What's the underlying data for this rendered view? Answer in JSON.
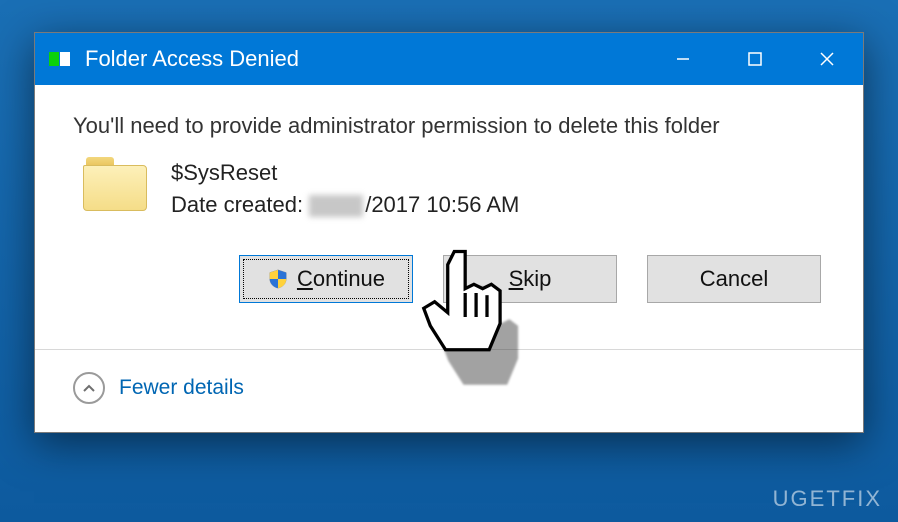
{
  "dialog": {
    "title": "Folder Access Denied",
    "message": "You'll need to provide administrator permission to delete this folder",
    "folder": {
      "name": "$SysReset",
      "date_label": "Date created:",
      "date_suffix": "/2017 10:56 AM"
    },
    "buttons": {
      "continue": "Continue",
      "skip": "Skip",
      "cancel": "Cancel"
    },
    "details_toggle": "Fewer details"
  },
  "watermark": "UGETFIX"
}
